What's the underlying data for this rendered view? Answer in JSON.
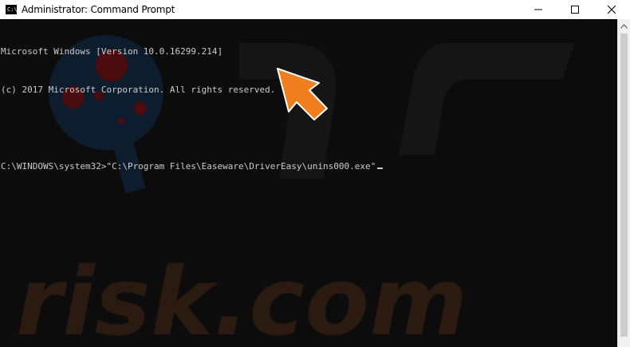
{
  "window": {
    "title": "Administrator: Command Prompt",
    "icon_text": "C:\\",
    "controls": [
      "minimize-icon",
      "maximize-icon",
      "close-icon"
    ]
  },
  "console": {
    "lines": [
      "Microsoft Windows [Version 10.0.16299.214]",
      "(c) 2017 Microsoft Corporation. All rights reserved.",
      "",
      "C:\\WINDOWS\\system32>\"C:\\Program Files\\Easeware\\DriverEasy\\unins000.exe\""
    ]
  },
  "annotation": {
    "arrow_color": "#f07d1e"
  },
  "watermark": {
    "text": "risk.com"
  },
  "colors": {
    "console_background": "#0c0c0c",
    "console_text": "#cccccc",
    "titlebar": "#ffffff"
  }
}
